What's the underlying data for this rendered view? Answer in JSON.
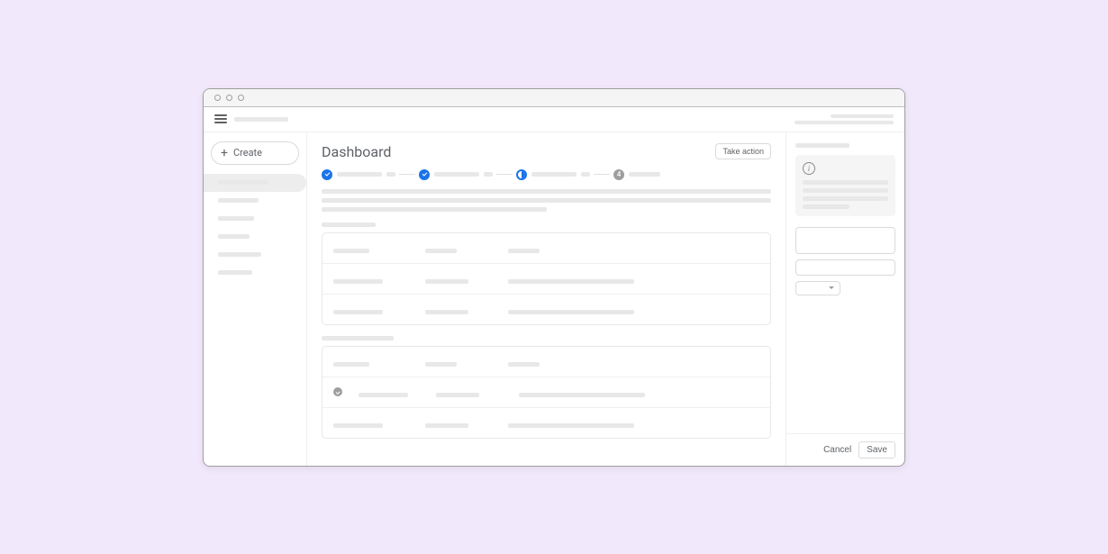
{
  "sidebar": {
    "create_label": "Create"
  },
  "main": {
    "title": "Dashboard",
    "action_label": "Take action"
  },
  "stepper": {
    "steps": [
      {
        "state": "done"
      },
      {
        "state": "done"
      },
      {
        "state": "active"
      },
      {
        "state": "pending",
        "label": "4"
      }
    ]
  },
  "right_panel": {
    "cancel_label": "Cancel",
    "save_label": "Save"
  }
}
